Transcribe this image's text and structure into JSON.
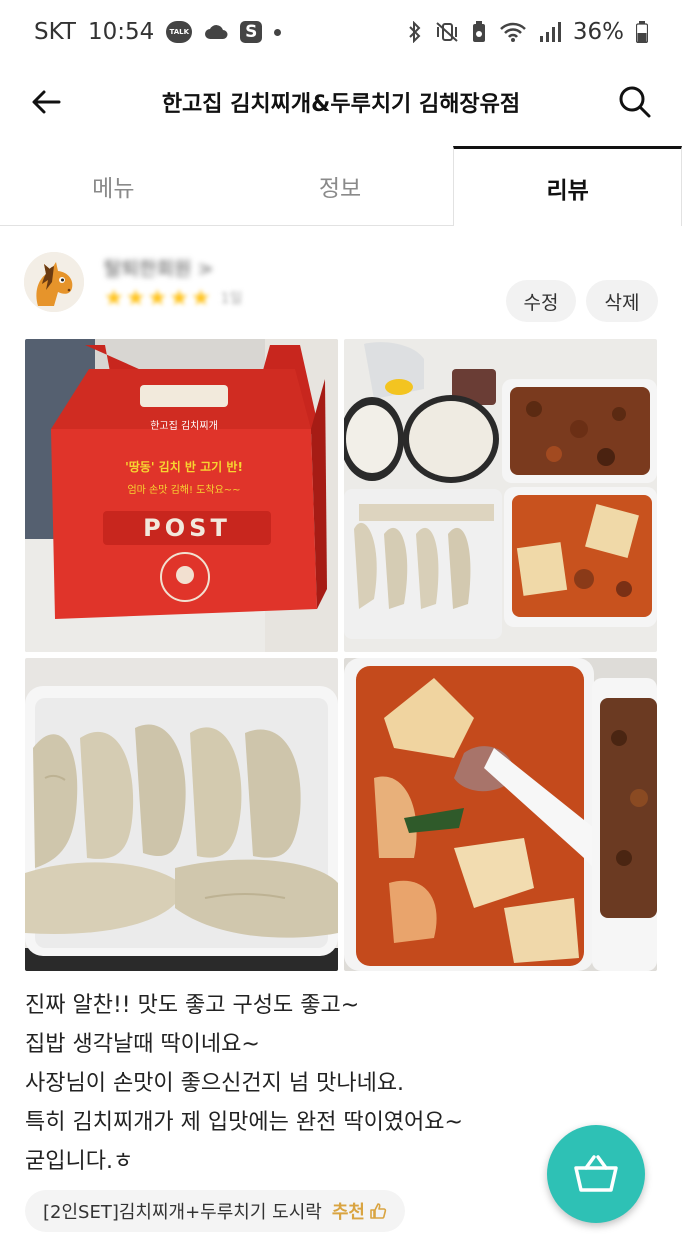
{
  "status_bar": {
    "carrier": "SKT",
    "time": "10:54",
    "talk_label": "TALK",
    "s_label": "S",
    "battery": "36%"
  },
  "header": {
    "title": "한고집 김치찌개&두루치기 김해장유점"
  },
  "tabs": [
    {
      "label": "메뉴",
      "active": false
    },
    {
      "label": "정보",
      "active": false
    },
    {
      "label": "리뷰",
      "active": true
    }
  ],
  "review": {
    "reviewer_name": "탈퇴한회원 >",
    "rating": 5,
    "date": "1일",
    "edit_label": "수정",
    "delete_label": "삭제",
    "photos": [
      {
        "name": "lunchbox-packaging",
        "box_text": "POST",
        "box_brand": "한고집 김치찌개",
        "box_slogan_1": "'땅동' 김치 반 고기 반!",
        "box_slogan_2": "엄마 손맛 김해! 도착요~~"
      },
      {
        "name": "full-meal-set"
      },
      {
        "name": "dumplings"
      },
      {
        "name": "kimchi-stew"
      }
    ],
    "text_lines": [
      "진짜 알찬!! 맛도 좋고 구성도 좋고~",
      "집밥 생각날때 딱이네요~",
      "사장님이 손맛이 좋으신건지 넘 맛나네요.",
      "특히 김치찌개가 제 입맛에는 완전 딱이였어요~",
      "굳입니다.ㅎ"
    ],
    "menu_tag": "[2인SET]김치찌개+두루치기 도시락",
    "recommend_label": "추천"
  },
  "colors": {
    "accent": "#2ec1b5",
    "star": "#ffc21a",
    "recommend": "#d9a441"
  },
  "icons": [
    "back-arrow-icon",
    "search-icon",
    "cart-icon",
    "thumbs-up-icon",
    "bluetooth-icon",
    "wifi-icon",
    "signal-icon",
    "battery-icon"
  ]
}
